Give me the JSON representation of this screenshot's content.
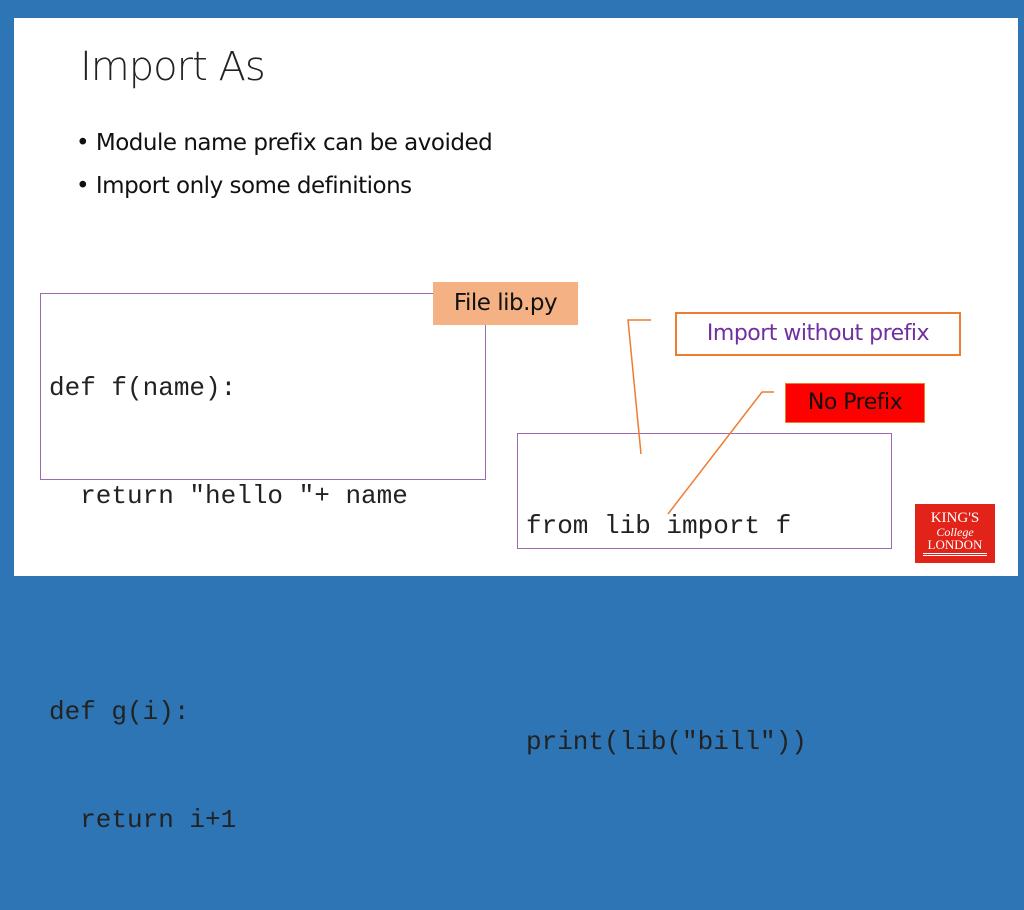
{
  "title": "Import As",
  "bullets": [
    "Module name prefix can be avoided",
    "Import only some definitions"
  ],
  "lib_code": [
    "def f(name):",
    "  return \"hello \"+ name",
    "",
    "def g(i):",
    "  return i+1"
  ],
  "file_label": "File lib.py",
  "callout_import": "Import without prefix",
  "callout_noprefix": "No Prefix",
  "main_code": [
    "from lib import f",
    "",
    "print(lib(\"bill\"))"
  ],
  "logo": "KING'S College LONDON",
  "colors": {
    "frame": "#2e75b6",
    "file_label_bg": "#f4b183",
    "callout_border": "#ed7d31",
    "callout_text": "#7030a0",
    "noprefix_bg": "#ff0000",
    "logo_bg": "#e2231a"
  }
}
